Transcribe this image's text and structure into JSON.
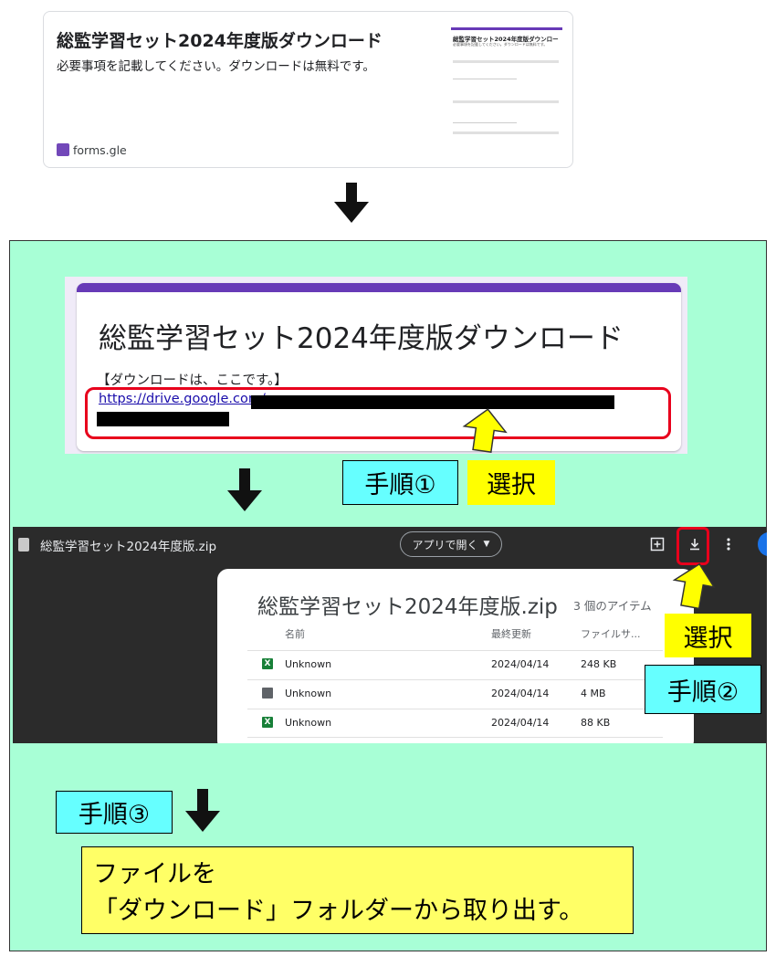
{
  "preview_card": {
    "title": "総監学習セット2024年度版ダウンロード",
    "description": "必要事項を記載してください。ダウンロードは無料です。",
    "domain": "forms.gle",
    "thumb_title": "総監学習セット2024年度版ダウンロー",
    "thumb_desc": "必要事項を記載してください。ダウンロードは無料です。"
  },
  "form": {
    "title": "総監学習セット2024年度版ダウンロード",
    "download_label": "【ダウンロードは、ここです。】",
    "link_text": "https://drive.google.com/"
  },
  "drive": {
    "filename": "総監学習セット2024年度版.zip",
    "open_with_label": "アプリで開く",
    "zip_title": "総監学習セット2024年度版.zip",
    "item_count": "3 個のアイテム",
    "headers": {
      "name": "名前",
      "modified": "最終更新",
      "size": "ファイルサ..."
    },
    "rows": [
      {
        "name": "Unknown",
        "modified": "2024/04/14",
        "size": "248 KB",
        "icon": "excel-icon"
      },
      {
        "name": "Unknown",
        "modified": "2024/04/14",
        "size": "4 MB",
        "icon": "document-icon"
      },
      {
        "name": "Unknown",
        "modified": "2024/04/14",
        "size": "88 KB",
        "icon": "excel-icon"
      }
    ]
  },
  "labels": {
    "step1": "手順①",
    "step2": "手順②",
    "step3": "手順③",
    "select1": "選択",
    "select2": "選択"
  },
  "final_instruction": {
    "line1": "ファイルを",
    "line2": "「ダウンロード」フォルダーから取り出す。"
  },
  "colors": {
    "green_panel": "#a8ffd6",
    "step_label": "#66ffff",
    "select_label": "#ffff00",
    "highlight_red": "#e8001c",
    "forms_purple": "#673ab7"
  }
}
